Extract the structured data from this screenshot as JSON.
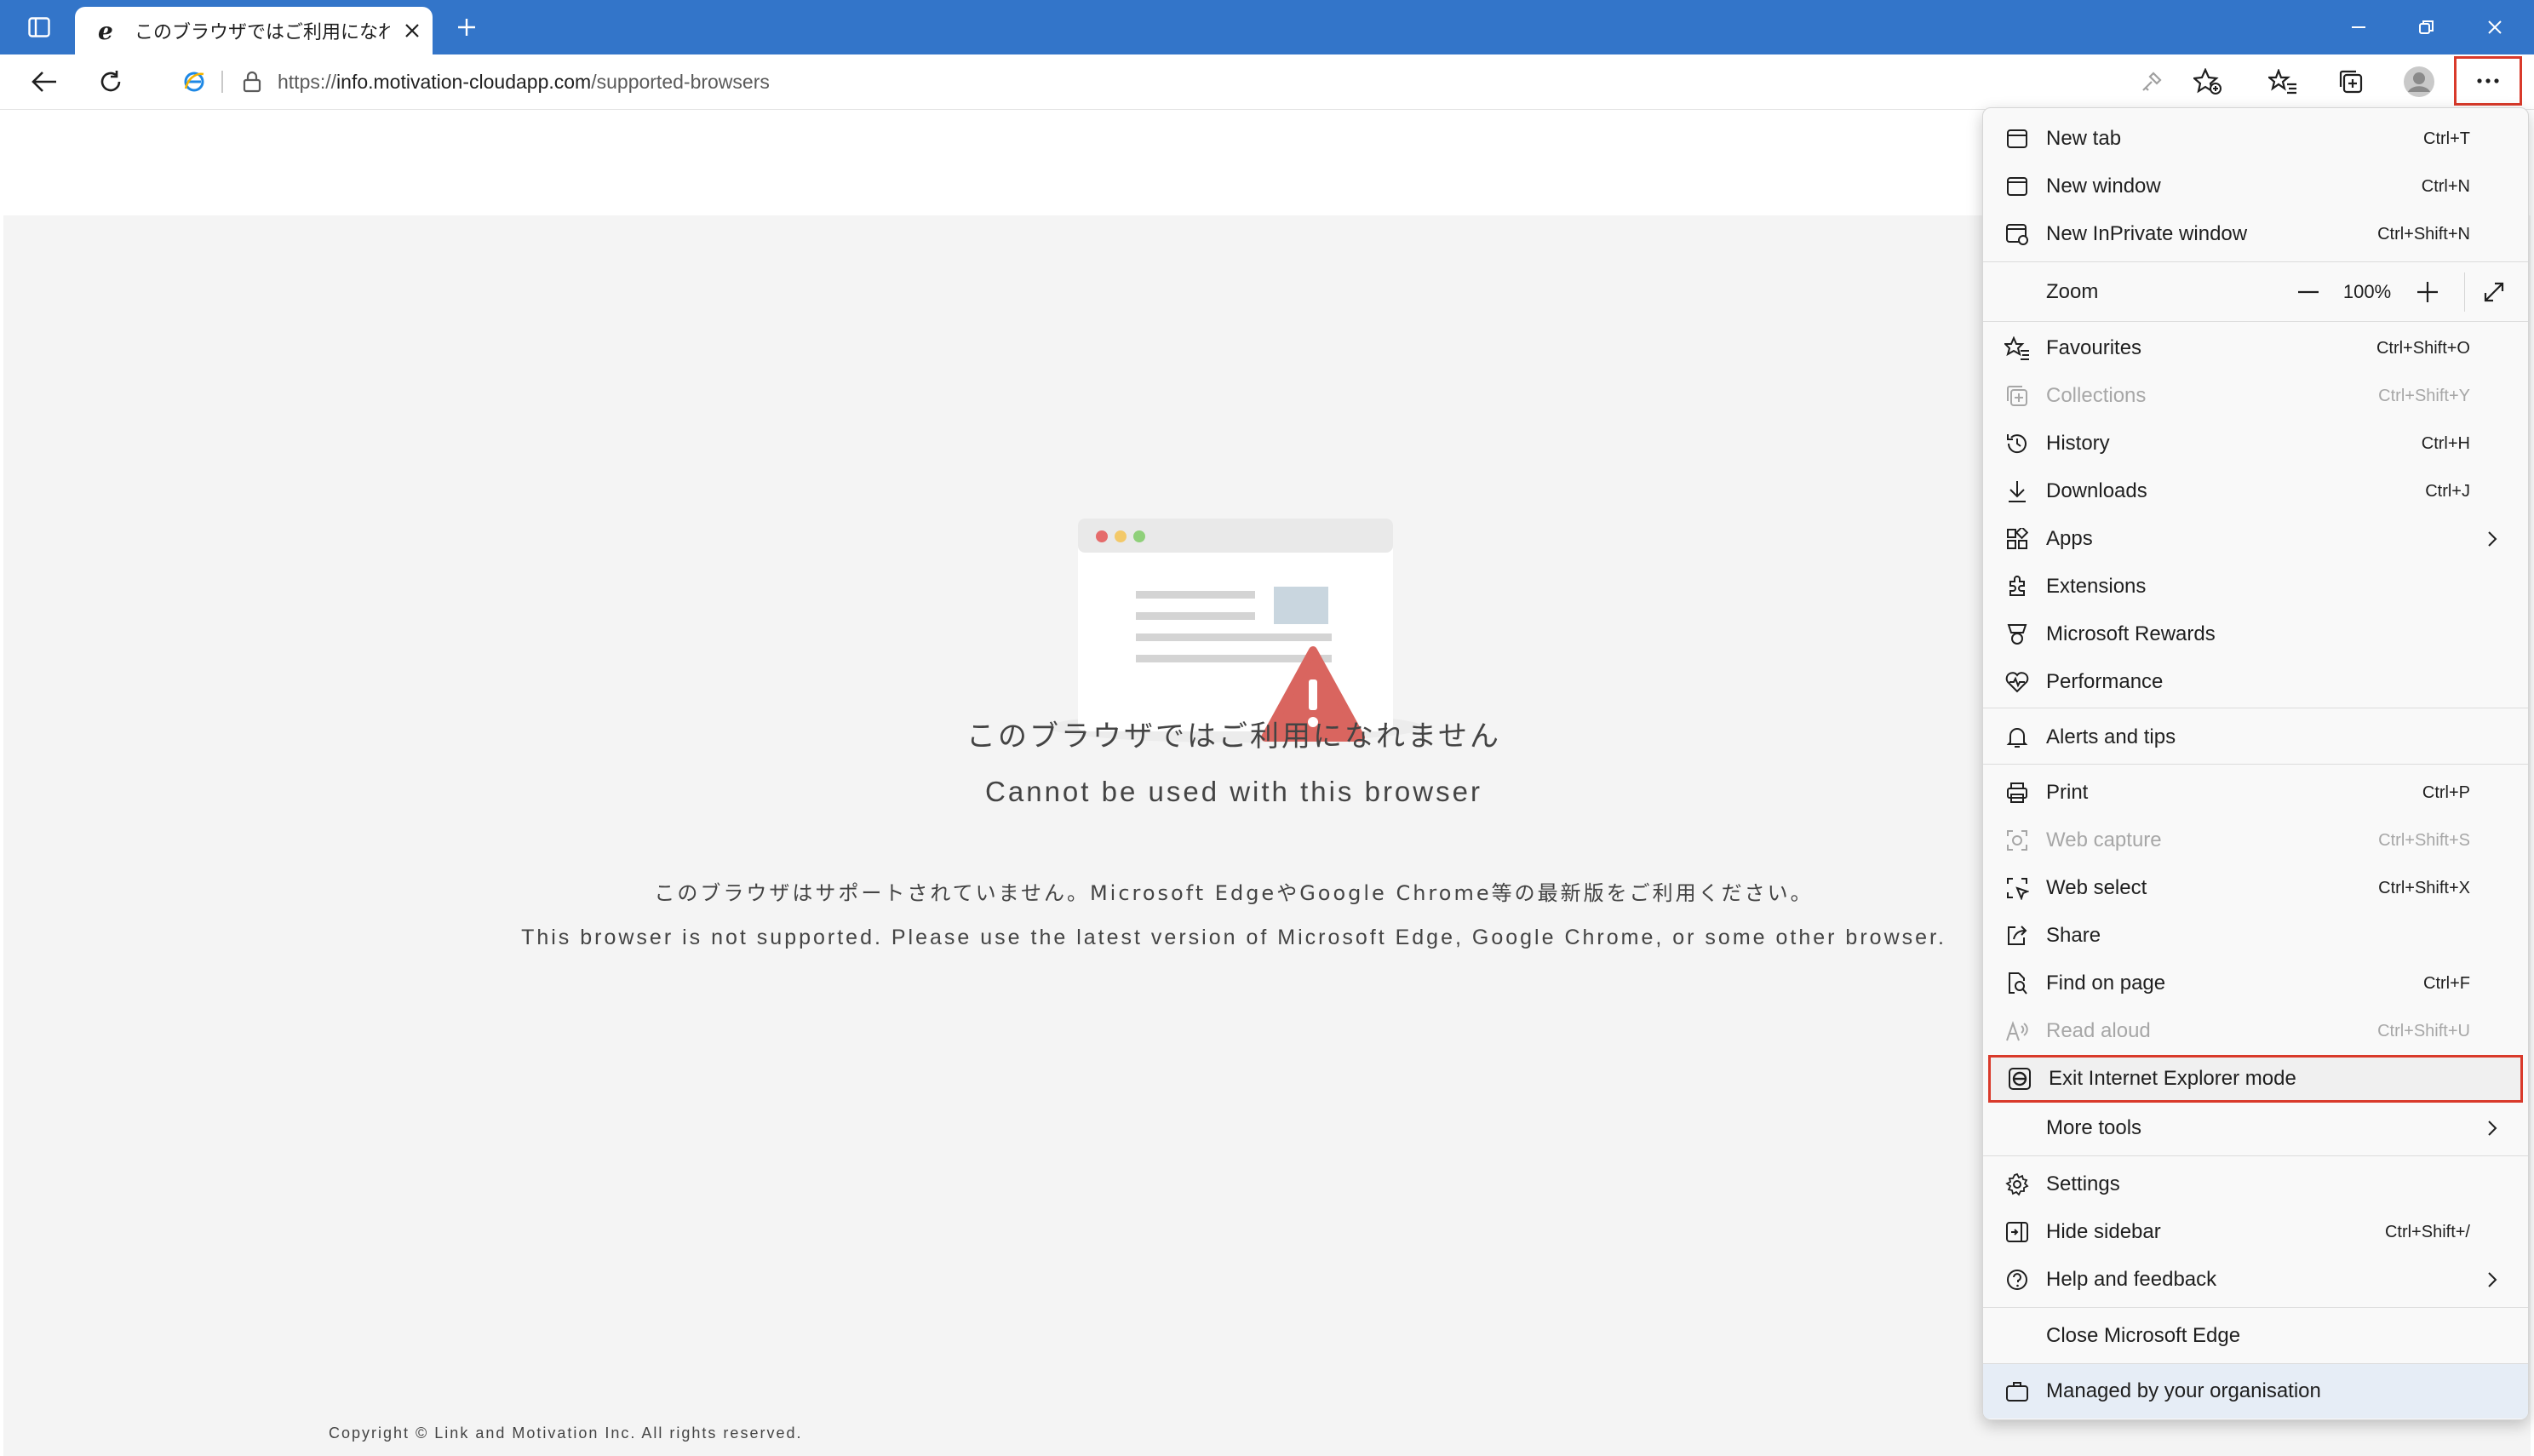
{
  "tab": {
    "title": "このブラウザではご利用になれません"
  },
  "address": {
    "url_prefix": "https://",
    "url_host": "info.motivation-cloudapp.com",
    "url_path": "/supported-browsers"
  },
  "page": {
    "title_jp": "このブラウザではご利用になれません",
    "title_en": "Cannot be used with this browser",
    "desc_jp": "このブラウザはサポートされていません。Microsoft EdgeやGoogle Chrome等の最新版をご利用ください。",
    "desc_en": "This browser is not supported. Please use the latest version of Microsoft Edge, Google Chrome, or some other browser.",
    "copyright": "Copyright © Link and Motivation Inc. All rights reserved."
  },
  "menu": {
    "new_tab": {
      "label": "New tab",
      "shortcut": "Ctrl+T"
    },
    "new_window": {
      "label": "New window",
      "shortcut": "Ctrl+N"
    },
    "new_inprivate": {
      "label": "New InPrivate window",
      "shortcut": "Ctrl+Shift+N"
    },
    "zoom": {
      "label": "Zoom",
      "value": "100%"
    },
    "favourites": {
      "label": "Favourites",
      "shortcut": "Ctrl+Shift+O"
    },
    "collections": {
      "label": "Collections",
      "shortcut": "Ctrl+Shift+Y"
    },
    "history": {
      "label": "History",
      "shortcut": "Ctrl+H"
    },
    "downloads": {
      "label": "Downloads",
      "shortcut": "Ctrl+J"
    },
    "apps": {
      "label": "Apps"
    },
    "extensions": {
      "label": "Extensions"
    },
    "rewards": {
      "label": "Microsoft Rewards"
    },
    "performance": {
      "label": "Performance"
    },
    "alerts": {
      "label": "Alerts and tips"
    },
    "print": {
      "label": "Print",
      "shortcut": "Ctrl+P"
    },
    "web_capture": {
      "label": "Web capture",
      "shortcut": "Ctrl+Shift+S"
    },
    "web_select": {
      "label": "Web select",
      "shortcut": "Ctrl+Shift+X"
    },
    "share": {
      "label": "Share"
    },
    "find": {
      "label": "Find on page",
      "shortcut": "Ctrl+F"
    },
    "read_aloud": {
      "label": "Read aloud",
      "shortcut": "Ctrl+Shift+U"
    },
    "exit_ie": {
      "label": "Exit Internet Explorer mode"
    },
    "more_tools": {
      "label": "More tools"
    },
    "settings": {
      "label": "Settings"
    },
    "hide_sidebar": {
      "label": "Hide sidebar",
      "shortcut": "Ctrl+Shift+/"
    },
    "help": {
      "label": "Help and feedback"
    },
    "close_edge": {
      "label": "Close Microsoft Edge"
    },
    "managed": {
      "label": "Managed by your organisation"
    }
  },
  "colors": {
    "titlebar": "#3375c9",
    "highlight": "#d93a2b",
    "warning": "#d9655f"
  }
}
